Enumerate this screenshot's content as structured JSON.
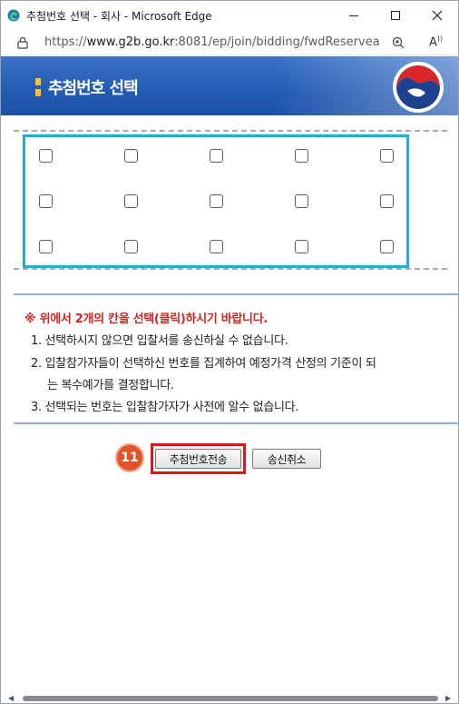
{
  "window": {
    "title": "추첨번호 선택 - 회사 - Microsoft Edge",
    "url_prefix": "https://",
    "url_host": "www.g2b.go.kr",
    "url_rest": ":8081/ep/join/bidding/fwdReservea..."
  },
  "header": {
    "title": "추첨번호 선택"
  },
  "instructions": {
    "warning": "※ 위에서 2개의 칸을 선택(클릭)하시기 바랍니다.",
    "items": [
      "1. 선택하시지 않으면 입찰서를 송신하실 수 없습니다.",
      "2. 입찰참가자들이 선택하신 번호를 집계하여 예정가격 산정의 기준이 되",
      "는 복수예가를 결정합니다.",
      "3. 선택되는 번호는 입찰참가자가 사전에 알수 없습니다."
    ]
  },
  "actions": {
    "step_badge": "11",
    "send_label": "추첨번호전송",
    "cancel_label": "송신취소"
  },
  "colors": {
    "header_blue": "#235bb3",
    "grid_border": "#29a8dc",
    "warning_red": "#d32424",
    "highlight_red": "#d61a1a",
    "badge_orange": "#e0542b"
  }
}
